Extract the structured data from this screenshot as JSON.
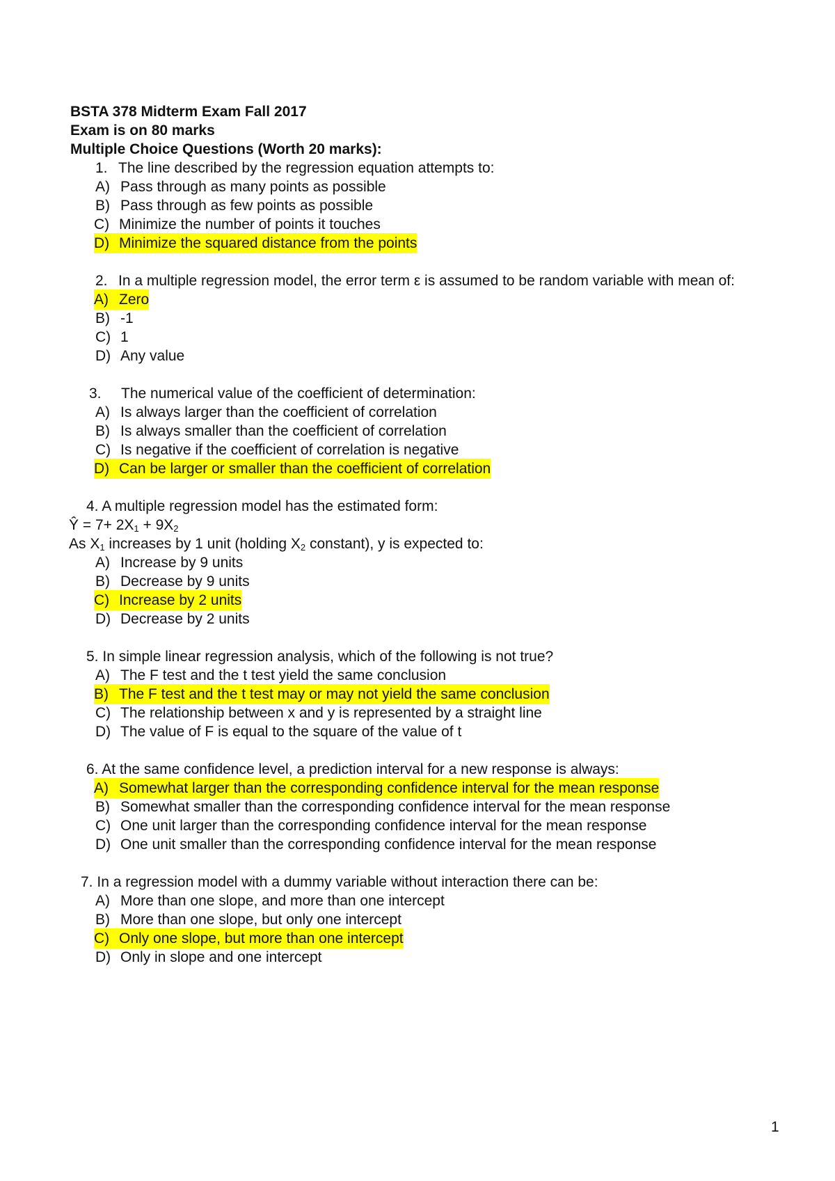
{
  "header": {
    "title": "BSTA 378 Midterm Exam Fall 2017",
    "total": "Exam is on 80 marks",
    "section": "Multiple Choice Questions (Worth 20 marks):"
  },
  "questions": [
    {
      "number": "1.",
      "text": "The line described by the regression equation attempts to:",
      "options": [
        {
          "letter": "A)",
          "text": "Pass through as many points as possible"
        },
        {
          "letter": "B)",
          "text": "Pass through as few points as possible"
        },
        {
          "letter": "C)",
          "text": "Minimize the number of points it touches"
        },
        {
          "letter": "D)",
          "text": "Minimize the squared distance from the points",
          "highlighted": true
        }
      ]
    },
    {
      "number": "2.",
      "text": "In a multiple regression model, the error term ε is assumed to be random variable with mean of:",
      "options": [
        {
          "letter": "A)",
          "text": "Zero",
          "highlighted": true
        },
        {
          "letter": "B)",
          "text": "-1"
        },
        {
          "letter": "C)",
          "text": "1"
        },
        {
          "letter": "D)",
          "text": "Any value"
        }
      ]
    },
    {
      "number": "3.",
      "text": "The numerical value of the coefficient of determination:",
      "options": [
        {
          "letter": "A)",
          "text": "Is always larger than the coefficient of correlation"
        },
        {
          "letter": "B)",
          "text": "Is always smaller than the coefficient of correlation"
        },
        {
          "letter": "C)",
          "text": "Is negative if the coefficient of correlation is negative"
        },
        {
          "letter": "D)",
          "text": "Can be larger or smaller than the coefficient of correlation",
          "highlighted": true
        }
      ]
    },
    {
      "number": "4.",
      "text": "A multiple regression model has the estimated form:",
      "equation": {
        "lhs": "Ŷ = 7+ 2X",
        "sub1": "1",
        "mid": " + 9X",
        "sub2": "2"
      },
      "stem": {
        "a": "As X",
        "sub1": "1",
        "b": " increases by 1 unit (holding X",
        "sub2": "2",
        "c": " constant), y is expected to:"
      },
      "options": [
        {
          "letter": "A)",
          "text": "Increase by 9 units"
        },
        {
          "letter": "B)",
          "text": "Decrease by 9 units"
        },
        {
          "letter": "C)",
          "text": "Increase by 2 units",
          "highlighted": true
        },
        {
          "letter": "D)",
          "text": "Decrease by 2 units"
        }
      ]
    },
    {
      "number": "5.",
      "text": "In simple linear regression analysis, which of the following is not true?",
      "options": [
        {
          "letter": "A)",
          "text": "The F test and the t test yield the same conclusion"
        },
        {
          "letter": "B)",
          "text": "The F test and the t test may or may not yield the same conclusion",
          "highlighted": true
        },
        {
          "letter": "C)",
          "text": "The relationship between x and y is represented by a straight line"
        },
        {
          "letter": "D)",
          "text": "The value of F is equal to the square of the value of t"
        }
      ]
    },
    {
      "number": "6.",
      "text": "At the same confidence level, a prediction interval for a new response is always:",
      "options": [
        {
          "letter": "A)",
          "text": "Somewhat larger than the corresponding confidence interval for the mean response",
          "highlighted": true
        },
        {
          "letter": "B)",
          "text": "Somewhat smaller than the corresponding confidence interval for the mean response"
        },
        {
          "letter": "C)",
          "text": "One unit larger than the corresponding confidence interval for the mean response"
        },
        {
          "letter": "D)",
          "text": "One unit smaller than the corresponding confidence interval for the mean response"
        }
      ]
    },
    {
      "number": "7.",
      "text": "In a regression model with a dummy variable without interaction there can be:",
      "options": [
        {
          "letter": "A)",
          "text": "More than one slope, and more than one intercept"
        },
        {
          "letter": "B)",
          "text": "More than one slope, but only one intercept"
        },
        {
          "letter": "C)",
          "text": "Only one slope, but more than one intercept",
          "highlighted": true
        },
        {
          "letter": "D)",
          "text": "Only in slope and one intercept"
        }
      ]
    }
  ],
  "footer": {
    "page_number": "1"
  },
  "colors": {
    "highlight": "#ffff00",
    "text": "#111111"
  }
}
